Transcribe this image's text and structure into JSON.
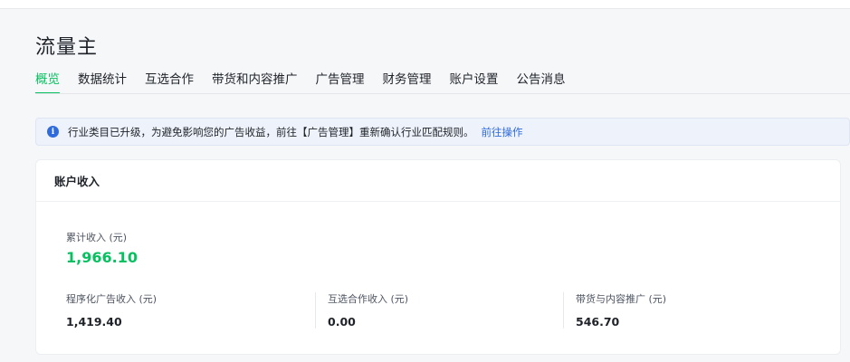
{
  "page": {
    "title": "流量主"
  },
  "tabs": [
    {
      "label": "概览",
      "active": true
    },
    {
      "label": "数据统计"
    },
    {
      "label": "互选合作"
    },
    {
      "label": "带货和内容推广"
    },
    {
      "label": "广告管理"
    },
    {
      "label": "财务管理"
    },
    {
      "label": "账户设置"
    },
    {
      "label": "公告消息"
    }
  ],
  "notice": {
    "icon": "info-icon",
    "text": "行业类目已升级，为避免影响您的广告收益，前往【广告管理】重新确认行业匹配规则。",
    "link": "前往操作"
  },
  "income_card": {
    "title": "账户收入",
    "total": {
      "label": "累计收入 (元)",
      "value": "1,966.10"
    },
    "items": [
      {
        "label": "程序化广告收入 (元)",
        "value": "1,419.40"
      },
      {
        "label": "互选合作收入 (元)",
        "value": "0.00"
      },
      {
        "label": "带货与内容推广 (元)",
        "value": "546.70"
      }
    ]
  },
  "colors": {
    "accent": "#07c160",
    "link": "#2f6bdc"
  }
}
